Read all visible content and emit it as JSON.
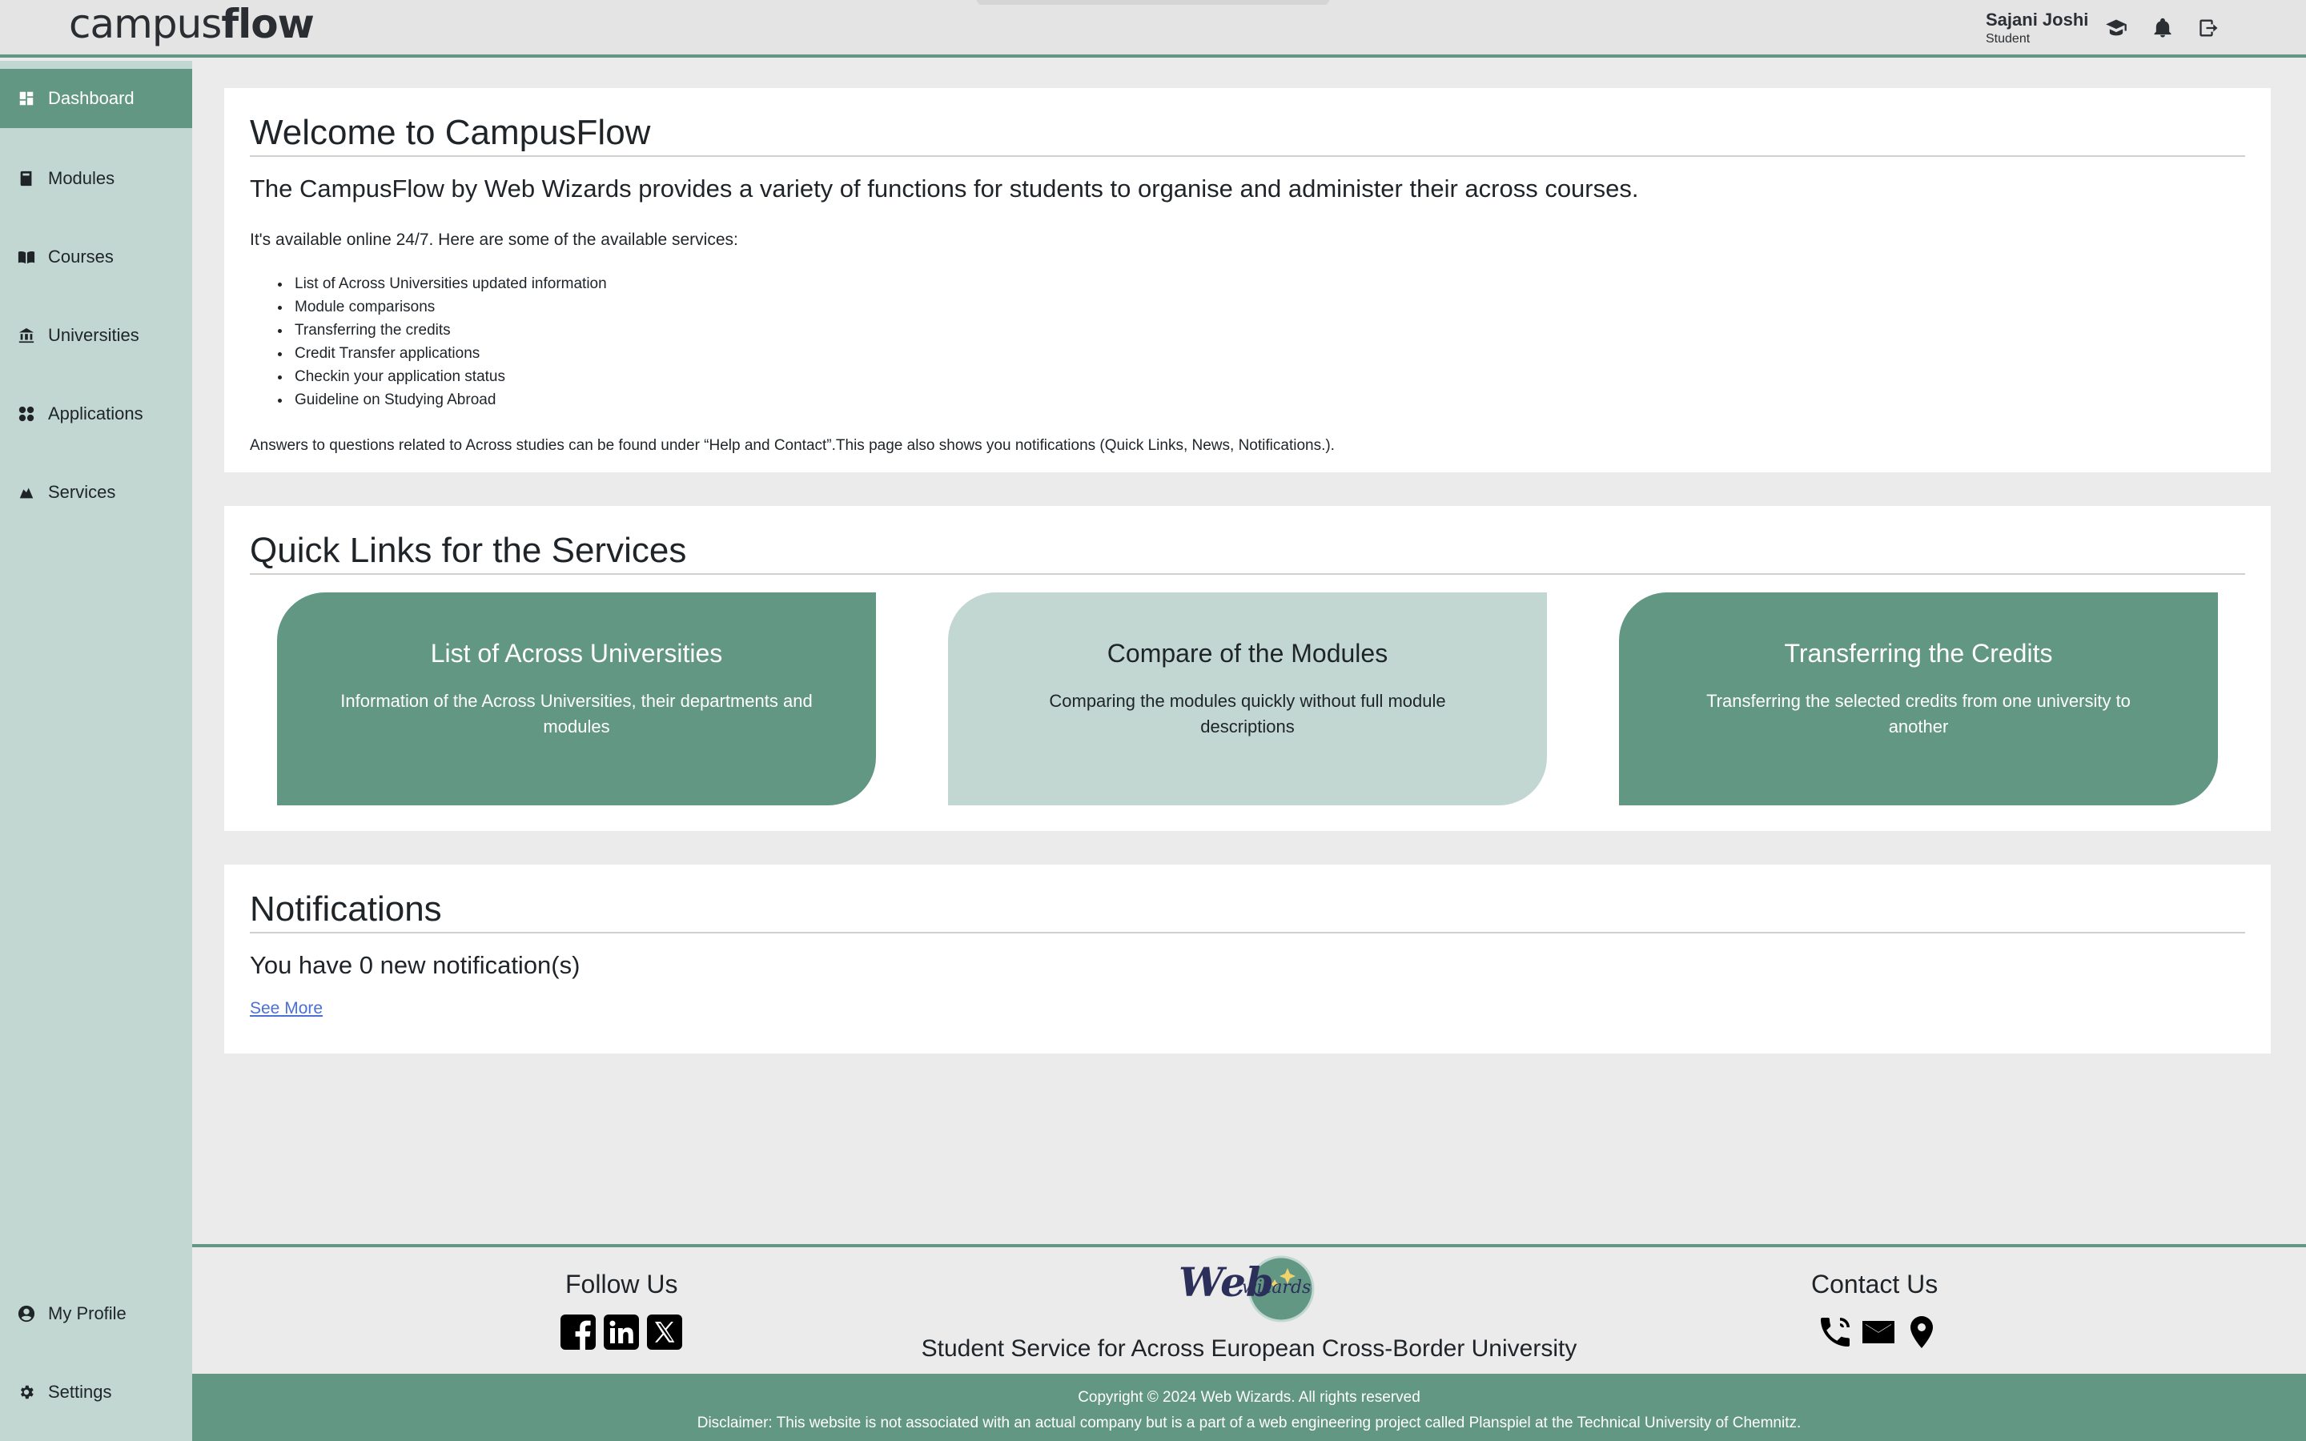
{
  "header": {
    "logo_light": "campus",
    "logo_bold": "flow",
    "user_name": "Sajani Joshi",
    "user_role": "Student",
    "icons": [
      "graduate-icon",
      "bell-icon",
      "logout-icon"
    ]
  },
  "sidebar": {
    "items": [
      {
        "label": "Dashboard",
        "icon": "dashboard-icon",
        "active": true
      },
      {
        "label": "Modules",
        "icon": "book-icon"
      },
      {
        "label": "Courses",
        "icon": "open-book-icon"
      },
      {
        "label": "Universities",
        "icon": "university-icon"
      },
      {
        "label": "Applications",
        "icon": "apps-icon"
      },
      {
        "label": "Services",
        "icon": "services-icon"
      }
    ],
    "bottom_items": [
      {
        "label": "My Profile",
        "icon": "profile-icon"
      },
      {
        "label": "Settings",
        "icon": "gear-icon"
      }
    ]
  },
  "welcome": {
    "title": "Welcome to CampusFlow",
    "lead": "The CampusFlow by Web Wizards provides a variety of functions for students to organise and administer their across courses.",
    "available": "It's available online 24/7. Here are some of the available services:",
    "services": [
      "List of Across Universities updated information",
      "Module comparisons",
      "Transferring the credits",
      "Credit Transfer applications",
      "Checkin your application status",
      "Guideline on Studying Abroad"
    ],
    "answers": "Answers to questions related to Across studies can be found under “Help and Contact”.This page also shows you notifications (Quick Links, News, Notifications.)."
  },
  "quick_links": {
    "title": "Quick Links for the Services",
    "cards": [
      {
        "title": "List of Across Universities",
        "desc": "Information of the Across Universities, their departments and modules"
      },
      {
        "title": "Compare of the Modules",
        "desc": "Comparing the modules quickly without full module descriptions"
      },
      {
        "title": "Transferring the Credits",
        "desc": "Transferring the selected credits from one university to another"
      }
    ]
  },
  "notifications": {
    "title": "Notifications",
    "count_text": "You have 0 new notification(s)",
    "see_more": "See More"
  },
  "footer": {
    "follow_us": "Follow Us",
    "contact_us": "Contact Us",
    "tagline": "Student Service for Across European Cross-Border University",
    "logo_text_a": "Web",
    "logo_text_b": "wizards",
    "copyright": "Copyright © 2024 Web Wizards. All rights reserved",
    "disclaimer": "Disclaimer: This website is not associated with an actual company but is a part of a web engineering project called Planspiel at the Technical University of Chemnitz."
  },
  "colors": {
    "accent": "#629784",
    "accent_light": "#c2d7d1",
    "background": "#ebebeb",
    "link": "#4a6fd6"
  }
}
